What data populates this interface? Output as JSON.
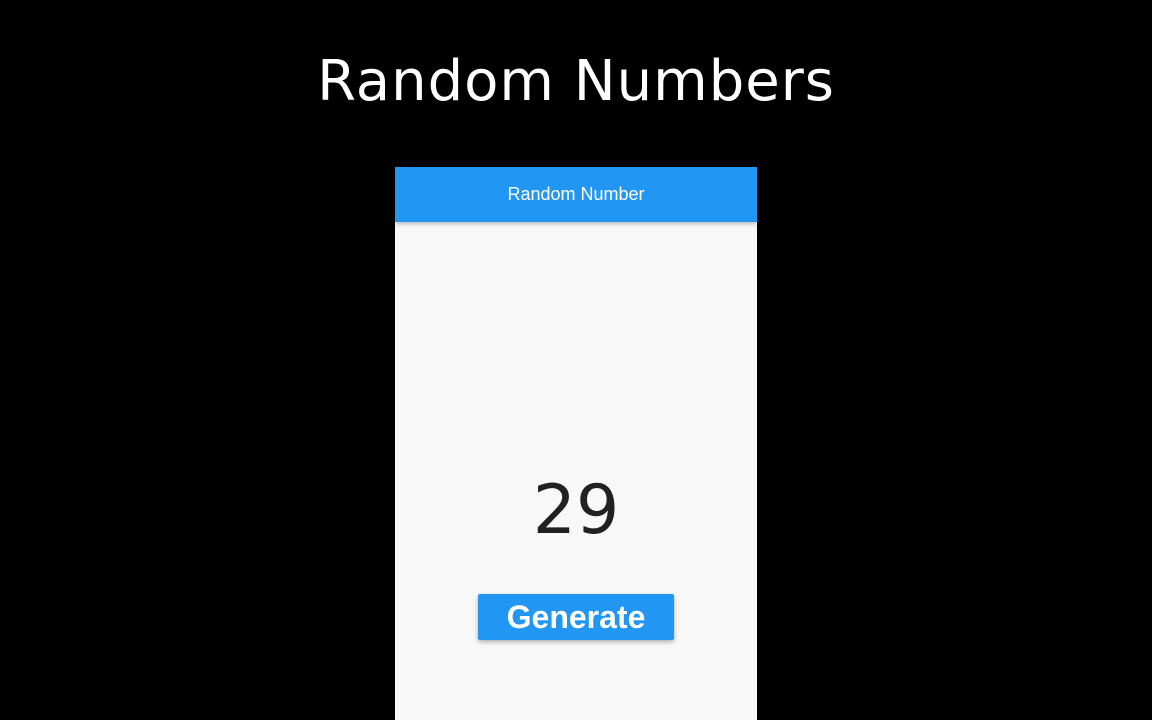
{
  "video": {
    "title": "Random Numbers"
  },
  "app": {
    "app_bar_title": "Random Number",
    "number": "29",
    "generate_label": "Generate"
  },
  "colors": {
    "background": "#000000",
    "primary": "#2196f3",
    "surface": "#f8f8f8",
    "text": "#212121",
    "on_primary": "#ffffff"
  }
}
